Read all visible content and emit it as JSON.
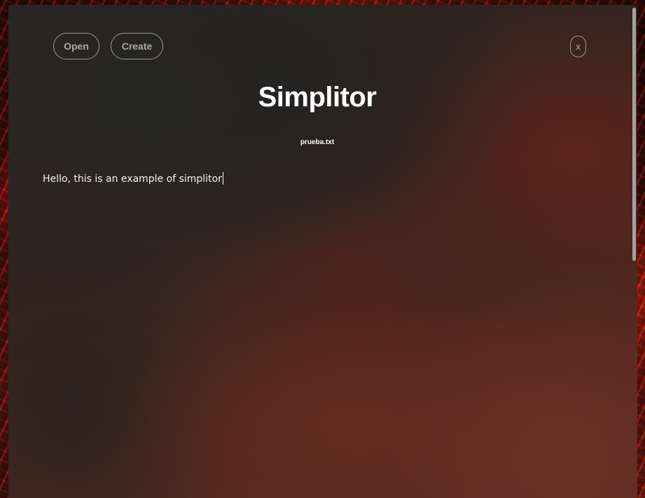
{
  "toolbar": {
    "open_label": "Open",
    "create_label": "Create",
    "close_label": "x"
  },
  "app": {
    "title": "Simplitor"
  },
  "file": {
    "name": "prueba.txt"
  },
  "editor": {
    "content": "Hello, this is an example of simplitor"
  },
  "colors": {
    "text": "#ffffff",
    "button_text": "#a9a9a9",
    "button_border": "#bebebe",
    "panel_dark": "#262422",
    "panel_warm": "#5e2e24",
    "backdrop_red": "#c81e14"
  },
  "scroll": {
    "visible_fraction": 0.52,
    "position": 0
  }
}
